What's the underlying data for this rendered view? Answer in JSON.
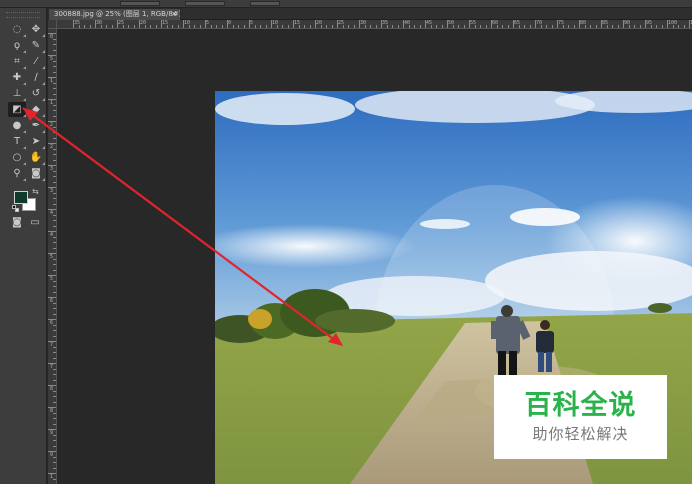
{
  "app": {
    "document_tab": "300888.jpg @ 25% (图层 1, RGB/8#) *",
    "close_glyph": "×"
  },
  "toolbar": {
    "tools": [
      {
        "name": "marquee-tool-icon",
        "glyph": "◌"
      },
      {
        "name": "move-tool-icon",
        "glyph": "✥"
      },
      {
        "name": "lasso-tool-icon",
        "glyph": "ϙ"
      },
      {
        "name": "quick-select-tool-icon",
        "glyph": "✎"
      },
      {
        "name": "crop-tool-icon",
        "glyph": "⌗"
      },
      {
        "name": "eyedropper-tool-icon",
        "glyph": "⁄"
      },
      {
        "name": "healing-brush-tool-icon",
        "glyph": "✚"
      },
      {
        "name": "brush-tool-icon",
        "glyph": "∕"
      },
      {
        "name": "clone-stamp-tool-icon",
        "glyph": "⊥"
      },
      {
        "name": "history-brush-tool-icon",
        "glyph": "↺"
      },
      {
        "name": "eraser-tool-icon",
        "glyph": "◩"
      },
      {
        "name": "paint-bucket-tool-icon",
        "glyph": "◆"
      },
      {
        "name": "dodge-tool-icon",
        "glyph": "●"
      },
      {
        "name": "pen-tool-icon",
        "glyph": "✒"
      },
      {
        "name": "type-tool-icon",
        "glyph": "T"
      },
      {
        "name": "path-select-tool-icon",
        "glyph": "➤"
      },
      {
        "name": "shape-tool-icon",
        "glyph": "○"
      },
      {
        "name": "hand-tool-icon",
        "glyph": "✋"
      },
      {
        "name": "zoom-tool-icon",
        "glyph": "⚲"
      },
      {
        "name": "quick-mask-icon",
        "glyph": "◙"
      },
      {
        "name": "screen-mode-icon",
        "glyph": "▭"
      }
    ],
    "active_tool": "eraser-tool-icon",
    "foreground_color": "#0f3a2c",
    "background_color": "#ffffff"
  },
  "rulers": {
    "top_numbers": [
      "35",
      "30",
      "25",
      "20",
      "15",
      "10",
      "5",
      "0",
      "5",
      "10",
      "15",
      "20",
      "25",
      "30",
      "35",
      "40",
      "45",
      "50",
      "55",
      "60",
      "65",
      "70",
      "75",
      "80",
      "85",
      "90",
      "95",
      "100",
      "105"
    ],
    "left_numbers": [
      "0",
      "5",
      "1",
      "1",
      "2",
      "2",
      "3",
      "3",
      "4",
      "4",
      "5",
      "5",
      "6",
      "6",
      "7",
      "7",
      "8",
      "8",
      "9",
      "9",
      "1"
    ]
  },
  "annotation": {
    "color": "#e3242b"
  },
  "watermark": {
    "title": "百科全说",
    "subtitle": "助你轻松解决",
    "title_color": "#2bb34b"
  }
}
